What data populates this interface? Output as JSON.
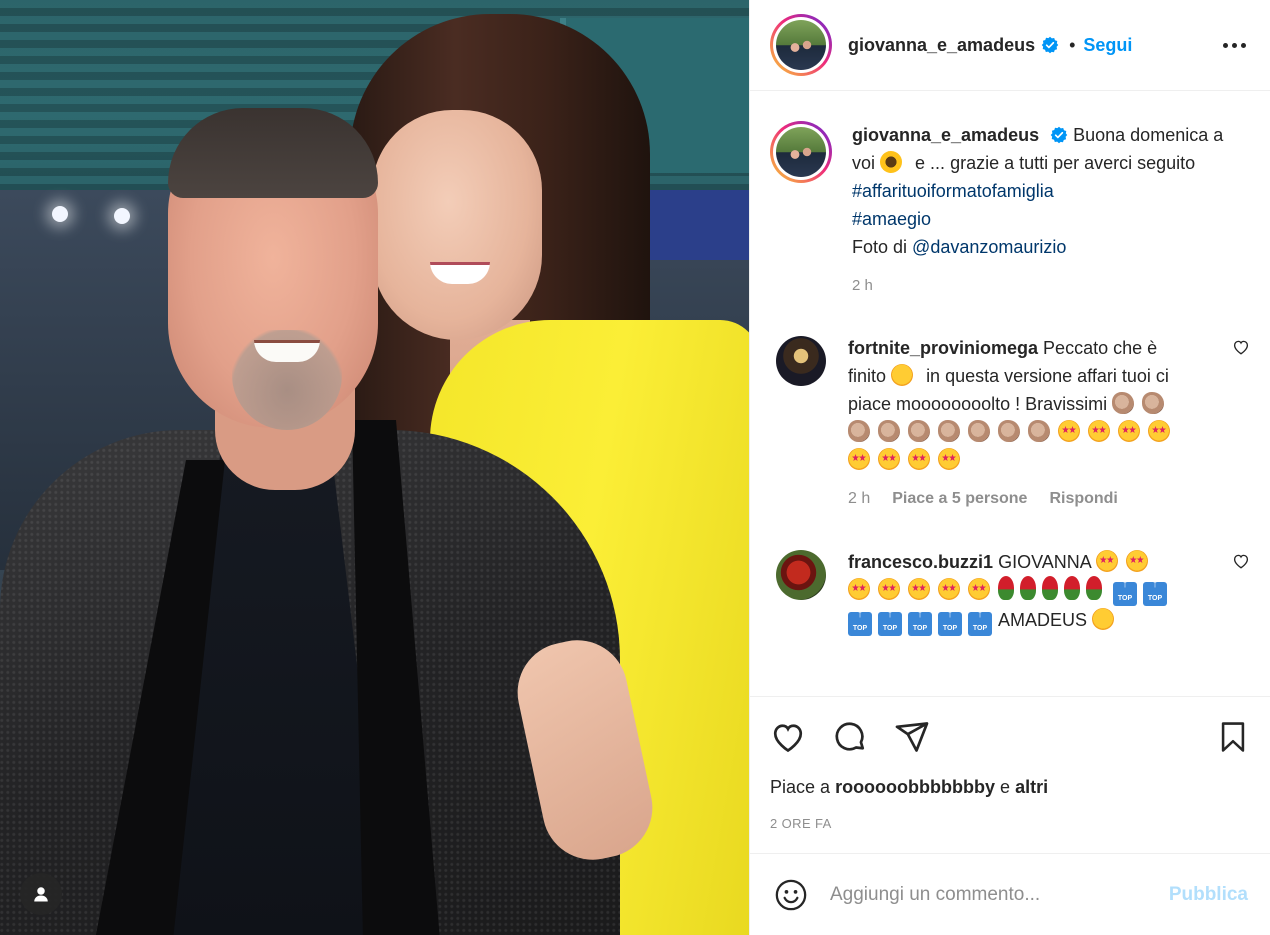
{
  "post": {
    "username": "giovanna_e_amadeus",
    "dot": "•",
    "follow_label": "Segui",
    "caption": {
      "p1": "Buona domenica a voi",
      "p2": "e ... grazie a tutti per averci seguito",
      "hashtag1": "#affarituoiformatofamiglia",
      "hashtag2": "#amaegio",
      "photo_prefix": "Foto di",
      "mention": "@davanzomaurizio",
      "time": "2 h"
    },
    "comments": [
      {
        "username": "fortnite_proviniomega",
        "p1": "Peccato che è finito",
        "p2": "in questa versione affari tuoi ci piace moooooooolto ! Bravissimi",
        "time": "2 h",
        "likes": "Piace a 5 persone",
        "reply": "Rispondi"
      },
      {
        "username": "francesco.buzzi1",
        "p1": "GIOVANNA",
        "p2": "AMADEUS",
        "top_label": "TOP"
      }
    ],
    "likes": {
      "prefix": "Piace a",
      "user": "roooooobbbbbbby",
      "conj": "e",
      "others": "altri"
    },
    "posted": "2 ORE FA",
    "add_comment": {
      "placeholder": "Aggiungi un commento...",
      "publish": "Pubblica"
    }
  },
  "colors": {
    "link_blue": "#0095f6",
    "hashtag_blue": "#00376b",
    "muted": "#8e8e8e",
    "publish_disabled": "#b2dffc",
    "photo_yellow": "#fbee36"
  },
  "icons": [
    "verified-badge-icon",
    "more-options-icon",
    "heart-icon",
    "comment-icon",
    "share-icon",
    "save-bookmark-icon",
    "emoji-smiley-icon",
    "user-tag-icon"
  ]
}
